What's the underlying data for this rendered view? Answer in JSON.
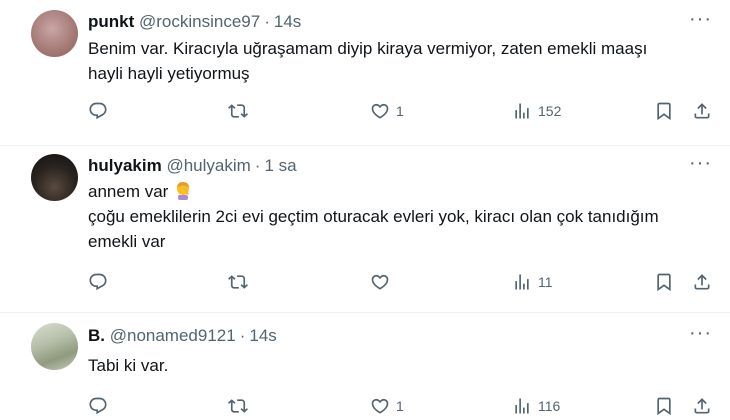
{
  "tweets": [
    {
      "name": "punkt",
      "handle": "@rockinsince97",
      "time": "14s",
      "lines": [
        "Benim var. Kiracıyla uğraşamam diyip kiraya vermiyor, zaten emekli maaşı",
        "hayli hayli yetiyormuş"
      ],
      "likes": "1",
      "views": "152"
    },
    {
      "name": "hulyakim",
      "handle": "@hulyakim",
      "time": "1 sa",
      "lines": [
        "annem var",
        "çoğu emeklilerin 2ci evi geçtim oturacak evleri yok, kiracı olan çok tanıdığım",
        "emekli var"
      ],
      "likes": "",
      "views": "11"
    },
    {
      "name": "B.",
      "handle": "@nonamed9121",
      "time": "14s",
      "lines": [
        "Tabi ki var."
      ],
      "likes": "1",
      "views": "116"
    }
  ],
  "separator": "·",
  "colors": {
    "text": "#0f1419",
    "secondary": "#536471",
    "divider": "#eff3f4"
  },
  "icons": [
    "reply-icon",
    "retweet-icon",
    "like-icon",
    "views-icon",
    "bookmark-icon",
    "share-icon",
    "more-icon",
    "person-facepalm-emoji"
  ]
}
